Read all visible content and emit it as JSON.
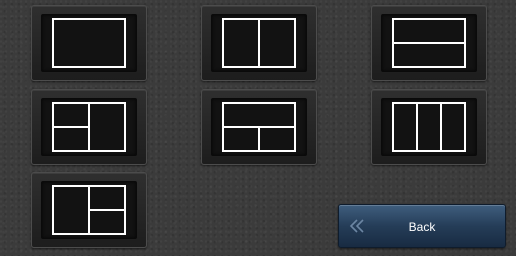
{
  "layout_options": [
    {
      "name": "layout-single-icon"
    },
    {
      "name": "layout-two-columns-icon"
    },
    {
      "name": "layout-two-rows-icon"
    },
    {
      "name": "layout-left-split-icon"
    },
    {
      "name": "layout-bottom-split-icon"
    },
    {
      "name": "layout-three-columns-icon"
    },
    {
      "name": "layout-right-split-icon"
    }
  ],
  "back_button": {
    "label": "Back",
    "icon": "double-chevron-left-icon"
  },
  "colors": {
    "background": "#3b3b3b",
    "button_face": "#121212",
    "icon_stroke": "#ffffff",
    "back_button": "#253d58"
  }
}
